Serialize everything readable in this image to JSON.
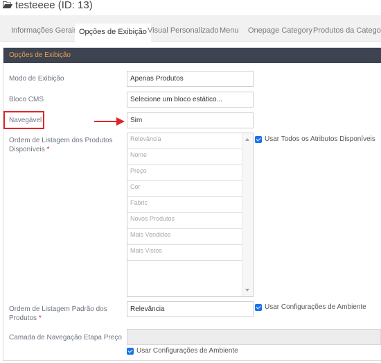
{
  "header": {
    "title": "testeeee (ID: 13)",
    "icon": "folder-open-icon"
  },
  "tabs": [
    {
      "label": "Informações Gerais",
      "active": false
    },
    {
      "label": "Opções de Exibição",
      "active": true
    },
    {
      "label": "Visual Personalizado",
      "active": false
    },
    {
      "label": "Menu",
      "active": false
    },
    {
      "label": "Onepage Category",
      "active": false
    },
    {
      "label": "Produtos da Categoria",
      "active": false
    }
  ],
  "panel": {
    "title": "Opções de Exibição"
  },
  "form": {
    "display_mode": {
      "label": "Modo de Exibição",
      "value": "Apenas Produtos"
    },
    "cms_block": {
      "label": "Bloco CMS",
      "value": "Selecione um bloco estático..."
    },
    "anchor": {
      "label": "Navegável",
      "value": "Sim"
    },
    "available_sort": {
      "label": "Ordem de Listagem dos Produtos Disponíveis",
      "required_mark": "*",
      "options": [
        "Relevância",
        "Nome",
        "Preço",
        "Cor",
        "Fabric",
        "Novos Produtos",
        "Mais Vendidos",
        "Mais Vistos"
      ],
      "checkbox_label": "Usar Todos os Atributos Disponíveis",
      "checkbox_checked": true
    },
    "default_sort": {
      "label": "Ordem de Listagem Padrão dos Produtos",
      "required_mark": "*",
      "value": "Relevância",
      "checkbox_label": "Usar Configurações de Ambiente",
      "checkbox_checked": true
    },
    "layered_nav": {
      "label": "Camada de Navegação Etapa Preço",
      "value": "",
      "checkbox_label": "Usar Configurações de Ambiente",
      "checkbox_checked": true
    }
  },
  "colors": {
    "panel_header_bg": "#3d4350",
    "panel_header_text": "#e8a04e",
    "annotation_red": "#e0242a",
    "checkbox_blue": "#1a73e8"
  }
}
